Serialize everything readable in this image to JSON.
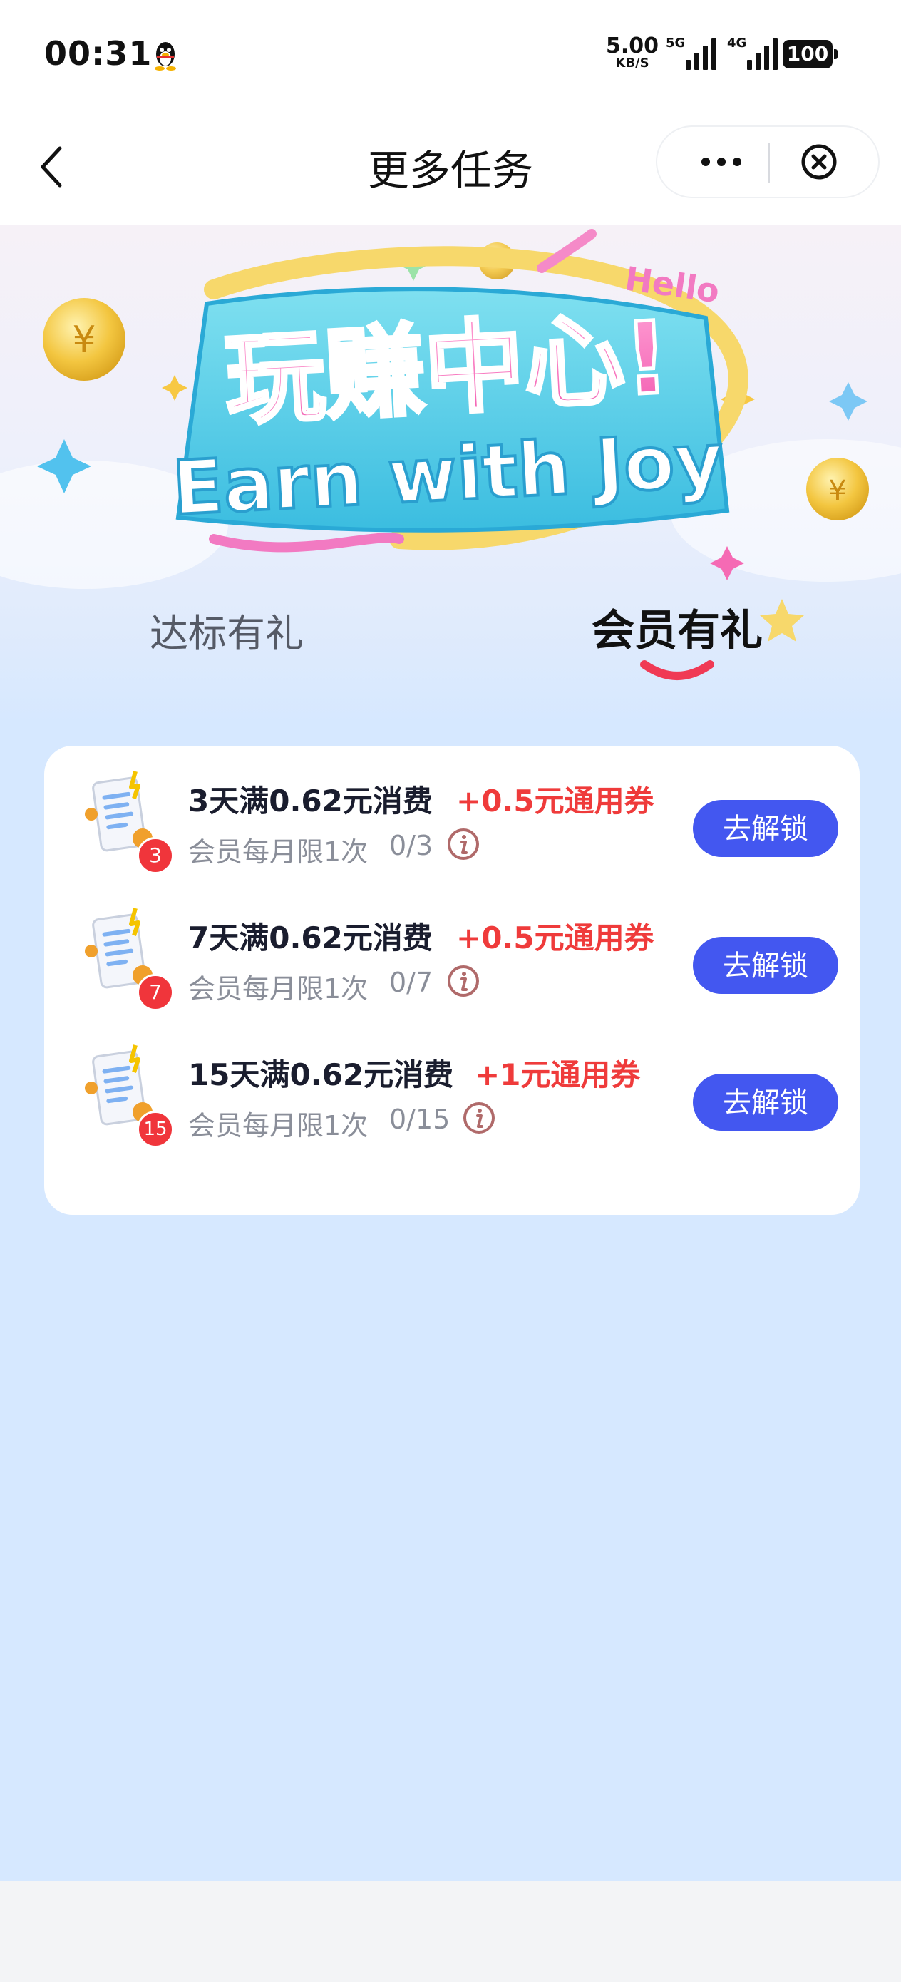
{
  "status_bar": {
    "time": "00:31",
    "net_speed": "5.00",
    "net_unit": "KB/S",
    "sig1": "5G",
    "sig2": "4G",
    "battery": "100"
  },
  "nav": {
    "title": "更多任务",
    "icons": {
      "back": "chevron-left-icon",
      "more": "more-dots-icon",
      "close": "close-circle-icon"
    }
  },
  "hero": {
    "title_cn": "玩赚中心!",
    "title_en": "Earn with Joy",
    "hello": "Hello"
  },
  "tabs": [
    {
      "label": "达标有礼",
      "active": false
    },
    {
      "label": "会员有礼",
      "active": true
    }
  ],
  "tasks": [
    {
      "badge": "3",
      "title": "3天满0.62元消费",
      "reward": "+0.5元通用券",
      "sub": "会员每月限1次",
      "progress": "0/3",
      "button": "去解锁"
    },
    {
      "badge": "7",
      "title": "7天满0.62元消费",
      "reward": "+0.5元通用券",
      "sub": "会员每月限1次",
      "progress": "0/7",
      "button": "去解锁"
    },
    {
      "badge": "15",
      "title": "15天满0.62元消费",
      "reward": "+1元通用券",
      "sub": "会员每月限1次",
      "progress": "0/15",
      "button": "去解锁"
    }
  ],
  "colors": {
    "page_bg": "#d6e8ff",
    "accent_button": "#4357f0",
    "reward_red": "#ef3b3b",
    "badge_red": "#f0353b"
  }
}
